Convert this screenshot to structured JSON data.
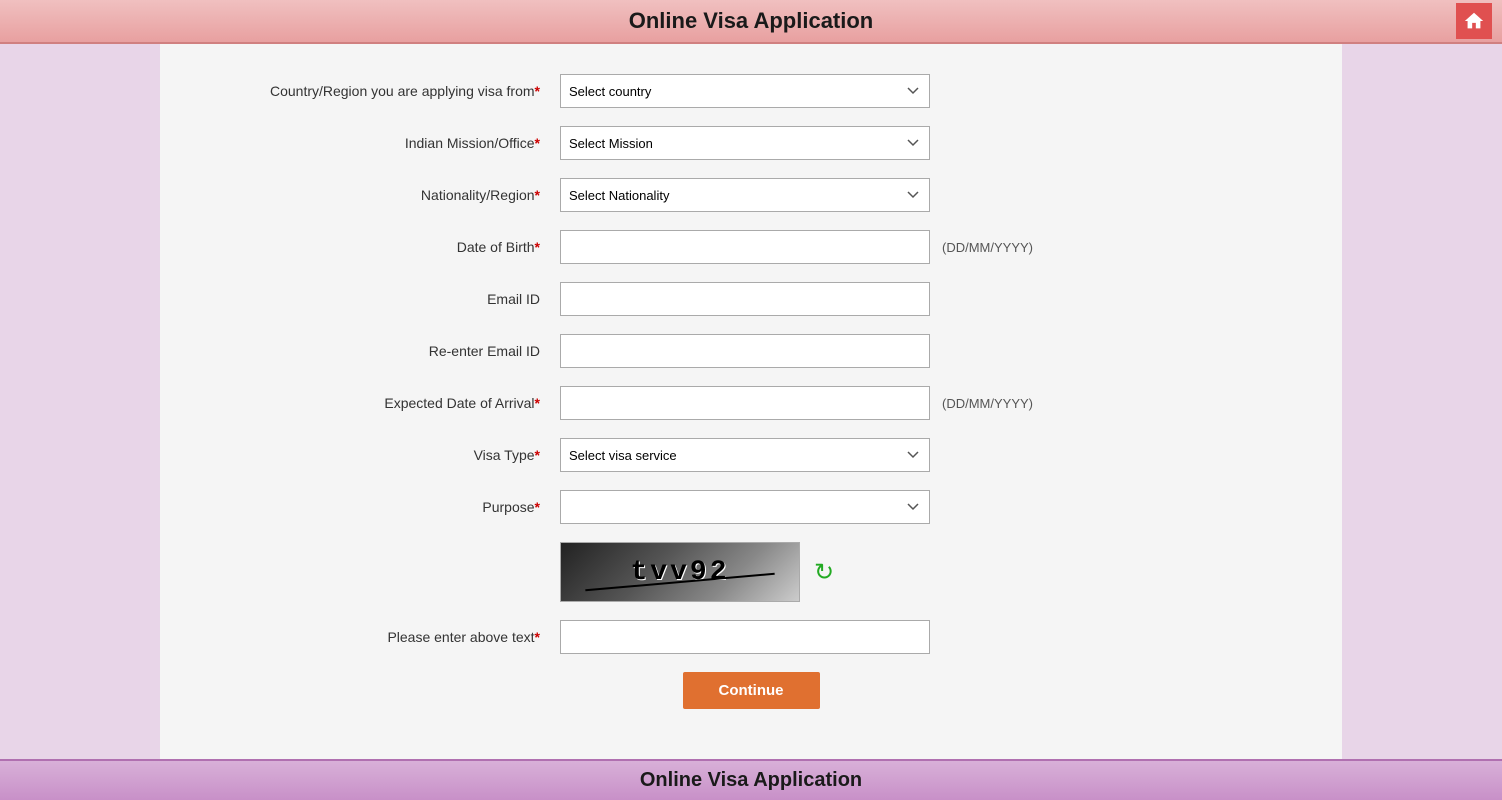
{
  "header": {
    "title": "Online Visa Application"
  },
  "footer": {
    "title": "Online Visa Application"
  },
  "form": {
    "fields": [
      {
        "id": "country",
        "label": "Country/Region you are applying visa from",
        "required": true,
        "type": "select",
        "placeholder": "Select country"
      },
      {
        "id": "mission",
        "label": "Indian Mission/Office",
        "required": true,
        "type": "select",
        "placeholder": "Select Mission"
      },
      {
        "id": "nationality",
        "label": "Nationality/Region",
        "required": true,
        "type": "select",
        "placeholder": "Select Nationality"
      },
      {
        "id": "dob",
        "label": "Date of Birth",
        "required": true,
        "type": "text",
        "hint": "(DD/MM/YYYY)"
      },
      {
        "id": "email",
        "label": "Email ID",
        "required": false,
        "type": "text"
      },
      {
        "id": "reenter_email",
        "label": "Re-enter Email ID",
        "required": false,
        "type": "text"
      },
      {
        "id": "arrival_date",
        "label": "Expected Date of Arrival",
        "required": true,
        "type": "text",
        "hint": "(DD/MM/YYYY)"
      },
      {
        "id": "visa_type",
        "label": "Visa Type",
        "required": true,
        "type": "select",
        "placeholder": "Select visa service"
      },
      {
        "id": "purpose",
        "label": "Purpose",
        "required": true,
        "type": "select",
        "placeholder": ""
      }
    ],
    "captcha": {
      "text": "tvv92",
      "label": "Please enter above text",
      "required": true
    },
    "continue_button": "Continue"
  },
  "icons": {
    "home": "🏠",
    "refresh": "↻",
    "chevron_down": "▾"
  }
}
